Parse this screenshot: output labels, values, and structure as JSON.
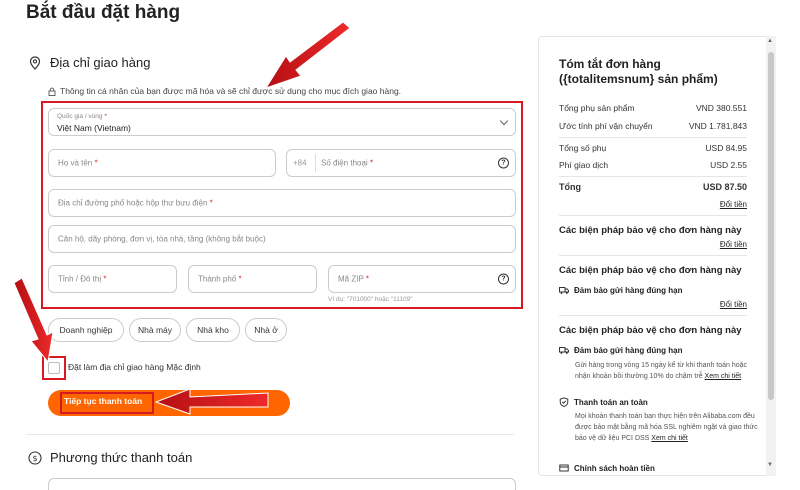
{
  "page_title": "Bắt đầu đặt hàng",
  "shipping": {
    "heading": "Địa chỉ giao hàng",
    "privacy_note": "Thông tin cá nhân của bạn được mã hóa và sẽ chỉ được sử dụng cho mục đích giao hàng.",
    "country_label": "Quốc gia / vùng",
    "country_value": "Việt Nam (Vietnam)",
    "full_name": "Họ và tên",
    "phone_code": "+84",
    "phone": "Số điện thoại",
    "street": "Địa chỉ đường phố hoặc hộp thư bưu điện",
    "apartment": "Căn hộ, dãy phòng, đơn vị, tòa nhà, tầng (không bắt buộc)",
    "province": "Tỉnh / Đô thị",
    "city": "Thành phố",
    "zip": "Mã ZIP",
    "zip_hint": "Ví dụ: \"701000\" hoặc \"11109\"",
    "required_mark": "*",
    "address_types": [
      "Doanh nghiệp",
      "Nhà máy",
      "Nhà kho",
      "Nhà ở"
    ],
    "default_checkbox_label": "Đặt làm địa chỉ giao hàng Mặc định",
    "continue_button": "Tiếp tục thanh toán"
  },
  "payment": {
    "heading": "Phương thức thanh toán"
  },
  "summary": {
    "title": "Tóm tắt đơn hàng ({totalitemsnum} sản phẩm)",
    "rows": [
      {
        "label": "Tổng phụ sản phẩm",
        "value": "VND 380.551"
      },
      {
        "label": "Ước tính phí vận chuyển",
        "value": "VND 1.781.843"
      },
      {
        "label": "Tổng số phụ",
        "value": "USD 84.95"
      },
      {
        "label": "Phí giao dịch",
        "value": "USD 2.55"
      },
      {
        "label": "Tổng",
        "value": "USD 87.50"
      }
    ],
    "change_currency": "Đổi tiền",
    "protection_heading": "Các biện pháp bảo vệ cho đơn hàng này",
    "on_time_title": "Đảm bảo gửi hàng đúng hạn",
    "on_time_desc": "Gửi hàng trong vòng 15 ngày kể từ khi thanh toán hoặc nhận khoản bồi thường 10% do chậm trễ",
    "see_details": "Xem chi tiết",
    "secure_title": "Thanh toán an toàn",
    "secure_desc": "Mọi khoản thanh toán bạn thực hiện trên Alibaba.com đều được bảo mật bằng mã hóa SSL nghiêm ngặt và giao thức bảo vệ dữ liệu PCI DSS",
    "refund_title": "Chính sách hoàn tiền"
  },
  "colors": {
    "accent": "#ff6600",
    "annotation_red": "#d51a20"
  }
}
